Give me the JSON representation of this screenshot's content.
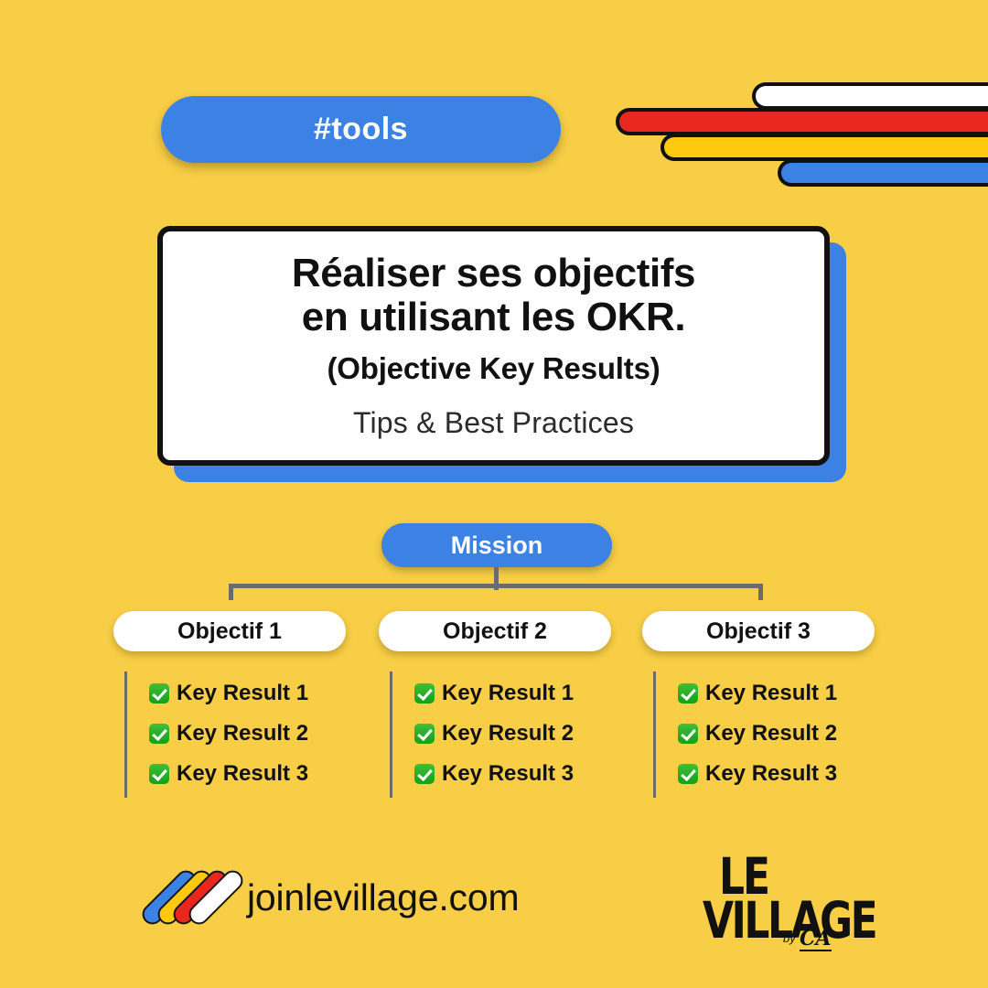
{
  "background_color": "#F7CE46",
  "accent_colors": {
    "blue": "#3C82E4",
    "red": "#E8281E",
    "yellow": "#FFC811",
    "white": "#FFFFFF",
    "black": "#111111",
    "green_check": "#14A014",
    "connector_gray": "#6B6B6B"
  },
  "tag_badge": {
    "label": "#tools"
  },
  "stripes": [
    {
      "name": "stripe-white",
      "color": "#FFFFFF"
    },
    {
      "name": "stripe-red",
      "color": "#E8281E"
    },
    {
      "name": "stripe-yellow",
      "color": "#FFC811"
    },
    {
      "name": "stripe-blue",
      "color": "#3C82E4"
    }
  ],
  "title_card": {
    "title_line_1": "Réaliser ses objectifs",
    "title_line_2": "en utilisant les OKR.",
    "subtitle": "(Objective Key Results)",
    "tagline": "Tips & Best Practices"
  },
  "diagram": {
    "mission_label": "Mission",
    "columns": [
      {
        "objective": "Objectif 1",
        "key_results": [
          "Key Result 1",
          "Key Result 2",
          "Key Result 3"
        ]
      },
      {
        "objective": "Objectif 2",
        "key_results": [
          "Key Result 1",
          "Key Result 2",
          "Key Result 3"
        ]
      },
      {
        "objective": "Objectif 3",
        "key_results": [
          "Key Result 1",
          "Key Result 2",
          "Key Result 3"
        ]
      }
    ]
  },
  "footer": {
    "site_url": "joinlevillage.com",
    "logo_icon": "four-diagonal-bars-logo",
    "village_logo": {
      "line_1": "LE",
      "line_2": "VILLAGE",
      "by_text": "by",
      "brand": "CA"
    }
  }
}
